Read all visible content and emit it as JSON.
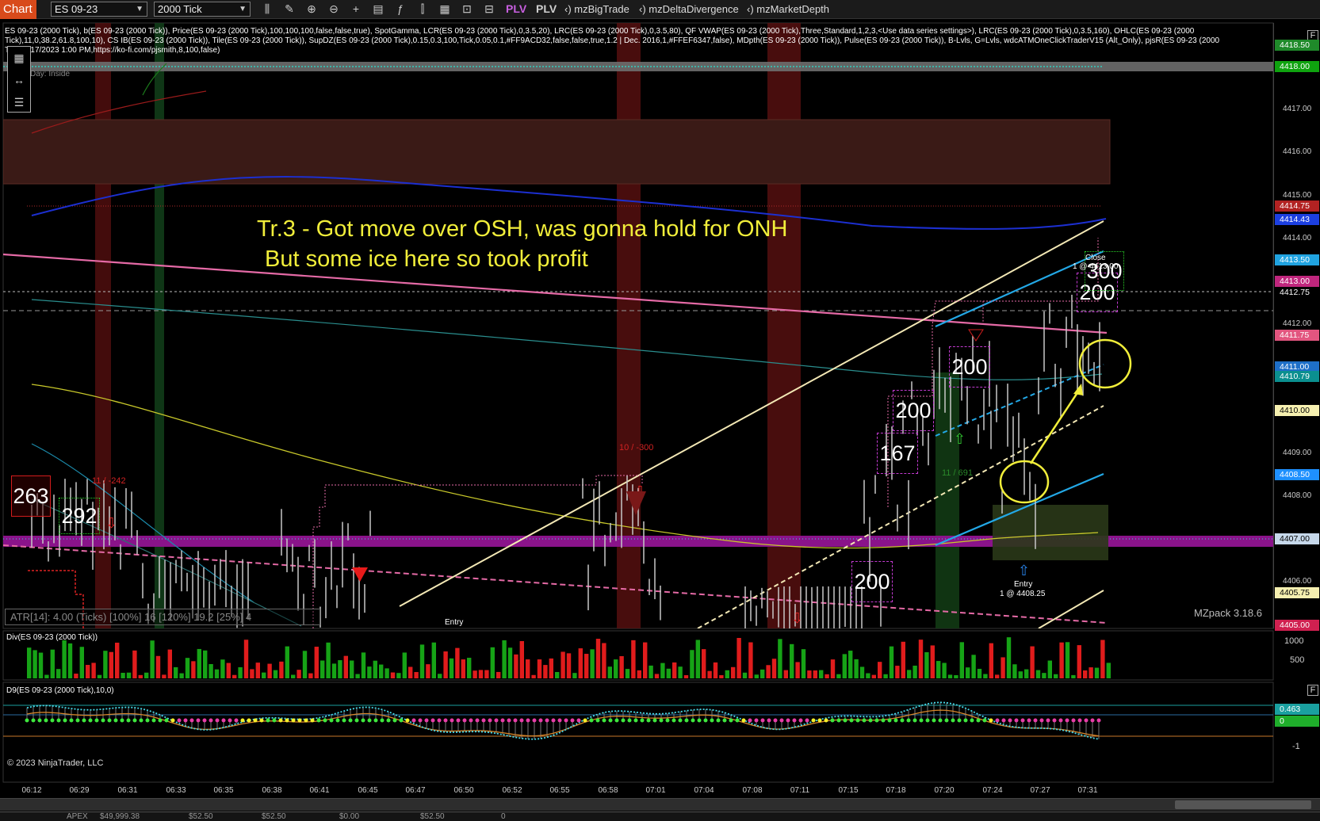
{
  "toolbar": {
    "chart_tab": "Chart",
    "instrument": "ES 09-23",
    "interval": "2000 Tick",
    "plv1": "PLV",
    "plv2": "PLV",
    "indicators": [
      "‹) mzBigTrade",
      "‹) mzDeltaDivergence",
      "‹) mzMarketDepth"
    ]
  },
  "price_panel": {
    "legend": "ES 09-23 (2000 Tick), b(ES 09-23 (2000 Tick)), Price(ES 09-23 (2000 Tick),100,100,100,false,false,true), SpotGamma, LCR(ES 09-23 (2000 Tick),0,3.5,20), LRC(ES 09-23 (2000 Tick),0,3.5,80), QF VWAP(ES 09-23 (2000 Tick),Three,Standard,1,2,3,<Use data series settings>), LRC(ES 09-23 (2000 Tick),0,3.5,160), OHLC(ES 09-23 (2000 Tick),11,0,38.2,61.8,100,10), CS IB(ES 09-23 (2000 Tick)), Tile(ES 09-23 (2000 Tick)), SupDZ(ES 09-23 (2000 Tick),0.15,0.3,100,Tick,0.05,0.1,#FF9ACD32,false,false,true,1.2 | Dec. 2016,1,#FFEF6347,false), MDpth(ES 09-23 (2000 Tick)), Pulse(ES 09-23 (2000 Tick)), B-Lvls, G=Lvls, wdcATMOneClickTraderV15 (Alt_Only), pjsR(ES 09-23 (2000 Tick),6/17/2023 1:00 PM,https://ko-fi.com/pjsmith,8,100,false)",
    "day_label": "Day: Inside",
    "annotation_line1": "Tr.3 - Got move over OSH, was gonna hold for ONH",
    "annotation_line2": "But some ice here so took profit",
    "atr": "ATR[14]: 4.00 (Ticks) [100%] 16  [120%] 19.2  [25%] 4",
    "version": "MZpack 3.18.6",
    "f_label": "F",
    "tile_values": [
      "263",
      "292",
      "167",
      "200",
      "200",
      "200",
      "200",
      "300"
    ],
    "delta_labels": [
      "11 / -242",
      "10 / -300",
      "11 / 691"
    ],
    "entry_label": "Entry",
    "entry_detail": "1 @ 4408.25",
    "close_label": "Close",
    "close_detail": "1 @ 4413.00"
  },
  "price_axis": {
    "ticks": [
      "4418.50",
      "4418.00",
      "4417.00",
      "4416.00",
      "4415.00",
      "4414.00",
      "4413.00",
      "4412.00",
      "4411.00",
      "4410.00",
      "4409.00",
      "4408.00",
      "4407.00",
      "4406.00",
      "4405.00"
    ],
    "tags": [
      {
        "text": "4418.50",
        "bg": "#1f8a2a",
        "fg": "#ffffff"
      },
      {
        "text": "4418.00",
        "bg": "#0fa30f",
        "fg": "#ffffff"
      },
      {
        "text": "4414.75",
        "bg": "#b22222",
        "fg": "#ffffff"
      },
      {
        "text": "4414.43",
        "bg": "#1c3fe0",
        "fg": "#ffffff"
      },
      {
        "text": "4413.50",
        "bg": "#20a3e0",
        "fg": "#ffffff"
      },
      {
        "text": "4413.00",
        "bg": "#c0267d",
        "fg": "#ffffff"
      },
      {
        "text": "4412.75",
        "bg": "#000000",
        "fg": "#ffffff"
      },
      {
        "text": "4411.75",
        "bg": "#e2557f",
        "fg": "#ffffff"
      },
      {
        "text": "4411.00",
        "bg": "#1e6fc8",
        "fg": "#ffffff"
      },
      {
        "text": "4410.79",
        "bg": "#0b8f8f",
        "fg": "#ffffff"
      },
      {
        "text": "4410.00",
        "bg": "#f6f0b0",
        "fg": "#000000"
      },
      {
        "text": "4408.50",
        "bg": "#1e90ff",
        "fg": "#ffffff"
      },
      {
        "text": "4407.00",
        "bg": "#c6d8ea",
        "fg": "#000000"
      },
      {
        "text": "4405.75",
        "bg": "#f5efb0",
        "fg": "#000000"
      },
      {
        "text": "4405.00",
        "bg": "#d02050",
        "fg": "#ffffff"
      }
    ]
  },
  "div_panel": {
    "title": "Div(ES 09-23 (2000 Tick))",
    "axis": [
      "1000",
      "500"
    ]
  },
  "d9_panel": {
    "title": "D9(ES 09-23 (2000 Tick),10,0)",
    "axis": [
      "-1"
    ],
    "tags": [
      {
        "text": "0.463",
        "bg": "#1aa0a0",
        "fg": "#ffffff"
      },
      {
        "text": "0",
        "bg": "#1fae2b",
        "fg": "#ffffff"
      }
    ],
    "copyright": "© 2023 NinjaTrader, LLC"
  },
  "time_axis": [
    "06:12",
    "06:29",
    "06:31",
    "06:33",
    "06:35",
    "06:38",
    "06:41",
    "06:45",
    "06:47",
    "06:50",
    "06:52",
    "06:55",
    "06:58",
    "07:01",
    "07:04",
    "07:08",
    "07:11",
    "07:15",
    "07:18",
    "07:20",
    "07:24",
    "07:27",
    "07:31"
  ],
  "bottom_strip": [
    "APEX",
    "$49,999.38",
    "$52.50",
    "$52.50",
    "$0.00",
    "$52.50",
    "0"
  ],
  "colors": {
    "accent": "#d84a1b",
    "annotation": "#f1ee3a",
    "magenta_band": "#8a138a",
    "bull": "#16a316",
    "bear": "#e01c1c"
  }
}
